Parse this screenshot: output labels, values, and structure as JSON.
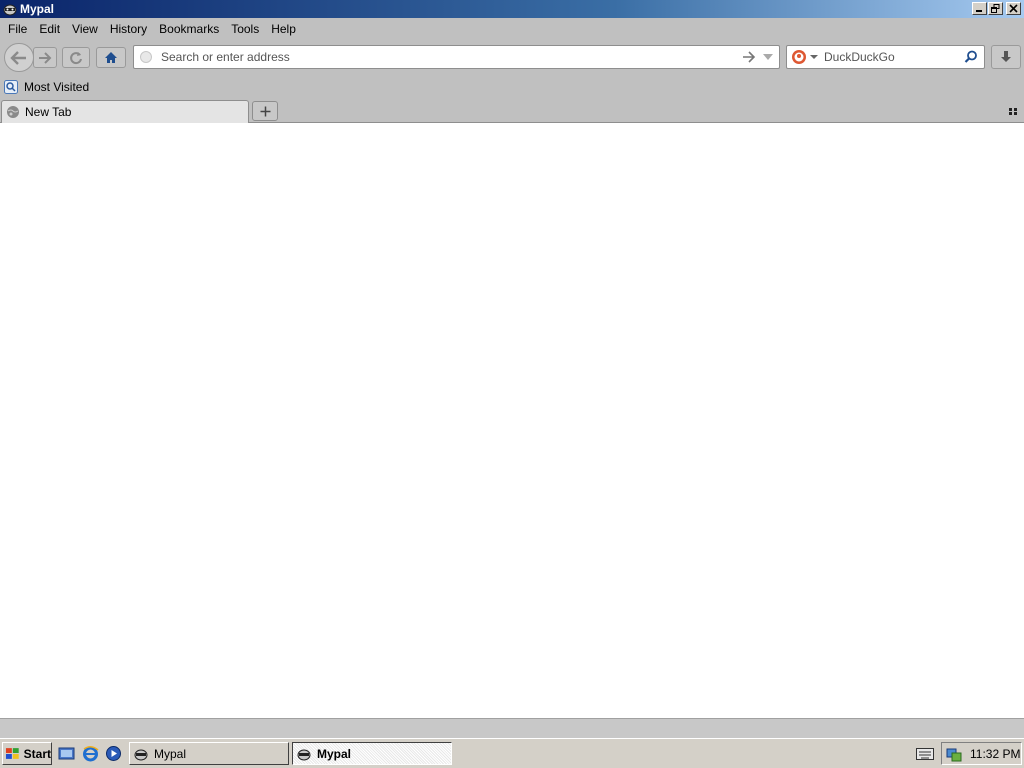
{
  "window": {
    "title": "Mypal",
    "icon": "raccoon-icon"
  },
  "menubar": {
    "items": [
      {
        "label": "File"
      },
      {
        "label": "Edit"
      },
      {
        "label": "View"
      },
      {
        "label": "History"
      },
      {
        "label": "Bookmarks"
      },
      {
        "label": "Tools"
      },
      {
        "label": "Help"
      }
    ]
  },
  "navbar": {
    "url_placeholder": "Search or enter address",
    "search_engine": "DuckDuckGo",
    "search_placeholder": "DuckDuckGo"
  },
  "bookmarks": {
    "items": [
      {
        "label": "Most Visited",
        "icon": "most-visited-icon"
      }
    ]
  },
  "tabs": [
    {
      "label": "New Tab",
      "active": true,
      "icon": "globe-icon"
    }
  ],
  "taskbar": {
    "start_label": "Start",
    "tasks": [
      {
        "label": "Mypal",
        "active": false
      },
      {
        "label": "Mypal",
        "active": true
      }
    ],
    "clock": "11:32 PM"
  },
  "colors": {
    "titlebar_start": "#0a246a",
    "titlebar_end": "#a6caf0",
    "chrome": "#c0c0c0",
    "taskbar": "#d4d0c8",
    "search_engine_accent": "#de5833"
  }
}
